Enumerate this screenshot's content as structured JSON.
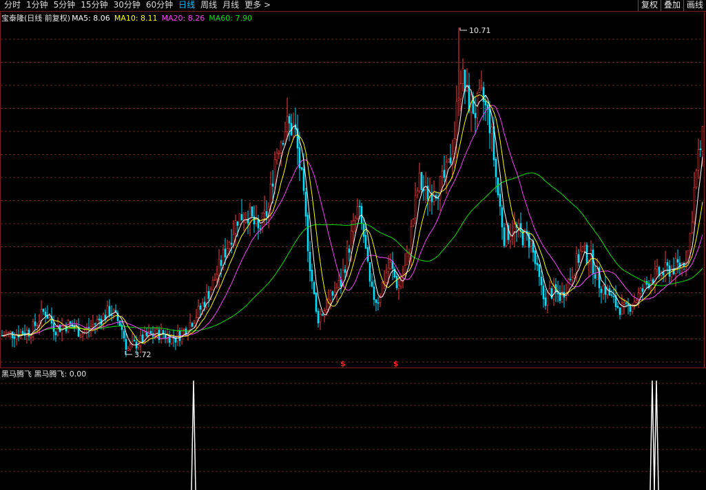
{
  "toolbar": {
    "tabs": [
      {
        "label": "分时"
      },
      {
        "label": "1分钟"
      },
      {
        "label": "5分钟"
      },
      {
        "label": "15分钟"
      },
      {
        "label": "30分钟"
      },
      {
        "label": "60分钟"
      },
      {
        "label": "日线"
      },
      {
        "label": "周线"
      },
      {
        "label": "月线"
      },
      {
        "label": "更多 >"
      }
    ],
    "active_tab": "日线",
    "tools": [
      {
        "label": "复权"
      },
      {
        "label": "叠加"
      },
      {
        "label": "画线"
      }
    ]
  },
  "main_chart": {
    "stock_title": "宝泰隆(日线 前复权)",
    "ma": [
      {
        "label": "MA5: 8.06",
        "color": "#ffffff"
      },
      {
        "label": "MA10: 8.11",
        "color": "#ffff00"
      },
      {
        "label": "MA20: 8.26",
        "color": "#ff3cff"
      },
      {
        "label": "MA60: 7.90",
        "color": "#00e600"
      }
    ],
    "high_label": "10.71",
    "low_label": "3.72",
    "signal_marks": [
      "$",
      "$"
    ]
  },
  "indicator": {
    "title": "黑马腾飞  黑马腾飞: 0.00"
  },
  "colors": {
    "up": "#ff3c3c",
    "down": "#00e0ff",
    "ma5": "#ffffff",
    "ma10": "#ffff00",
    "ma20": "#ff3cff",
    "ma60": "#00e600",
    "grid": "#7a1d1d"
  },
  "chart_data": {
    "type": "candlestick",
    "title": "宝泰隆(日线 前复权)",
    "price_max": 10.71,
    "price_min": 3.72,
    "close_trend": [
      [
        0,
        4.05
      ],
      [
        20,
        4.1
      ],
      [
        45,
        4.15
      ],
      [
        65,
        4.6
      ],
      [
        80,
        4.2
      ],
      [
        100,
        4.3
      ],
      [
        120,
        4.1
      ],
      [
        145,
        4.4
      ],
      [
        160,
        4.6
      ],
      [
        175,
        4.3
      ],
      [
        185,
        3.75
      ],
      [
        200,
        3.9
      ],
      [
        215,
        4.05
      ],
      [
        235,
        4.1
      ],
      [
        255,
        4.0
      ],
      [
        270,
        4.2
      ],
      [
        290,
        4.6
      ],
      [
        310,
        5.2
      ],
      [
        330,
        6.0
      ],
      [
        345,
        6.6
      ],
      [
        360,
        6.7
      ],
      [
        375,
        6.3
      ],
      [
        390,
        6.8
      ],
      [
        400,
        8.0
      ],
      [
        415,
        8.6
      ],
      [
        428,
        8.5
      ],
      [
        438,
        7.4
      ],
      [
        450,
        5.6
      ],
      [
        460,
        4.4
      ],
      [
        470,
        4.6
      ],
      [
        485,
        5.0
      ],
      [
        495,
        5.2
      ],
      [
        510,
        6.2
      ],
      [
        520,
        6.8
      ],
      [
        528,
        6.2
      ],
      [
        538,
        5.0
      ],
      [
        548,
        4.8
      ],
      [
        558,
        5.3
      ],
      [
        566,
        5.6
      ],
      [
        578,
        5.1
      ],
      [
        590,
        5.6
      ],
      [
        600,
        6.6
      ],
      [
        608,
        7.4
      ],
      [
        618,
        7.1
      ],
      [
        628,
        7.2
      ],
      [
        640,
        7.3
      ],
      [
        650,
        7.6
      ],
      [
        660,
        8.4
      ],
      [
        668,
        9.8
      ],
      [
        678,
        9.2
      ],
      [
        690,
        8.9
      ],
      [
        700,
        9.2
      ],
      [
        712,
        8.6
      ],
      [
        722,
        7.2
      ],
      [
        732,
        6.2
      ],
      [
        745,
        6.4
      ],
      [
        758,
        6.2
      ],
      [
        770,
        6.1
      ],
      [
        780,
        5.4
      ],
      [
        790,
        4.8
      ],
      [
        800,
        5.0
      ],
      [
        815,
        4.9
      ],
      [
        830,
        5.4
      ],
      [
        845,
        5.9
      ],
      [
        858,
        5.7
      ],
      [
        870,
        5.2
      ],
      [
        882,
        5.0
      ],
      [
        895,
        4.7
      ],
      [
        908,
        4.6
      ],
      [
        920,
        4.8
      ],
      [
        932,
        5.0
      ],
      [
        945,
        5.3
      ],
      [
        960,
        5.4
      ],
      [
        975,
        5.5
      ],
      [
        990,
        5.6
      ],
      [
        1000,
        5.9
      ],
      [
        1008,
        7.2
      ],
      [
        1015,
        8.0
      ],
      [
        1022,
        8.4
      ]
    ]
  }
}
